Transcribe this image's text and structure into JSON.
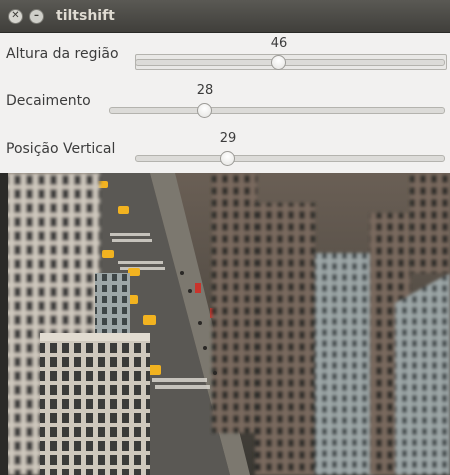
{
  "window": {
    "title": "tiltshift",
    "close_icon": "close-icon",
    "minimize_icon": "minimize-icon"
  },
  "sliders": [
    {
      "label": "Altura da região",
      "value": "46",
      "fraction": 0.46
    },
    {
      "label": "Decaimento",
      "value": "28",
      "fraction": 0.28
    },
    {
      "label": "Posição Vertical",
      "value": "29",
      "fraction": 0.29
    }
  ],
  "image": {
    "subject": "tilt-shift city street photo"
  },
  "colors": {
    "titlebar": "#403f3b",
    "panel": "#f2f1f0",
    "taxi": "#f2b320"
  }
}
